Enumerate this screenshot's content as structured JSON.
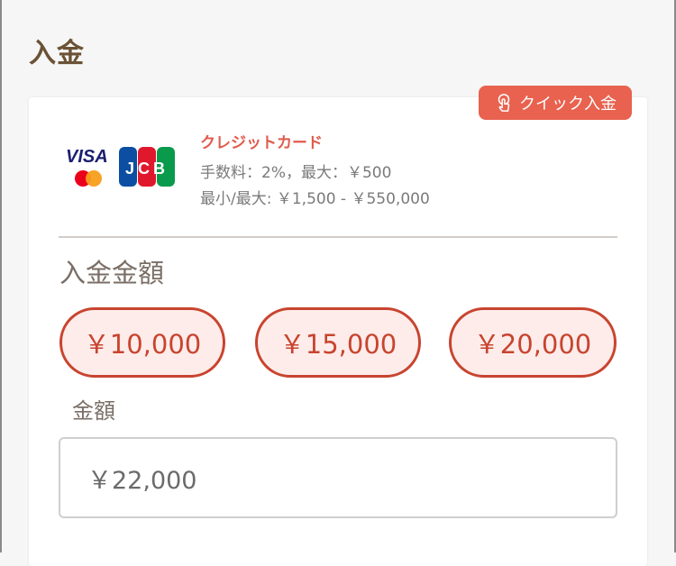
{
  "page": {
    "title": "入金"
  },
  "quick_deposit": {
    "label": "クイック入金",
    "icon": "hand-tap-icon"
  },
  "payment_method": {
    "logos": {
      "visa": "VISA",
      "jcb": "JCB"
    },
    "name": "クレジットカード",
    "fee": "手数料：2%，最大：￥500",
    "range": "最小/最大: ￥1,500 - ￥550,000"
  },
  "amount_section": {
    "title": "入金金額",
    "presets": [
      "￥10,000",
      "￥15,000",
      "￥20,000"
    ],
    "field_label": "金額",
    "field_value": "￥22,000"
  },
  "colors": {
    "accent": "#c8442f",
    "badge": "#e8624f",
    "title_brown": "#6b5236"
  }
}
